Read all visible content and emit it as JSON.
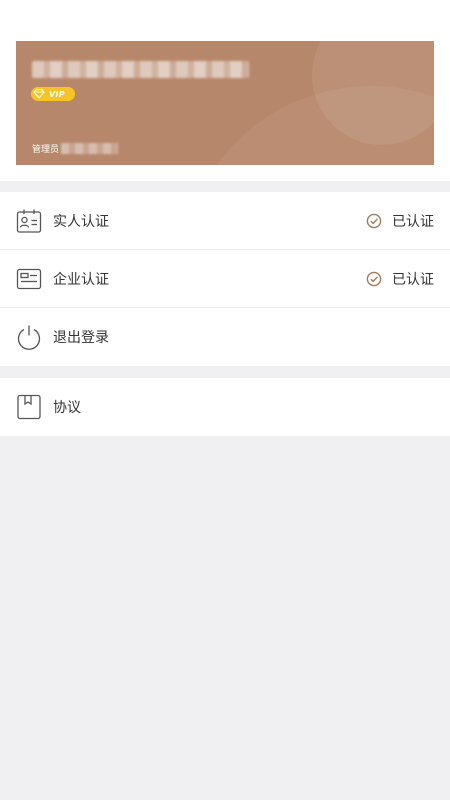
{
  "profile": {
    "vip_label": "VIP",
    "role_label": "管理员"
  },
  "menu": [
    {
      "label": "实人认证",
      "status": "已认证",
      "icon": "id-card-icon"
    },
    {
      "label": "企业认证",
      "status": "已认证",
      "icon": "business-card-icon"
    },
    {
      "label": "退出登录",
      "icon": "power-icon"
    }
  ],
  "secondary": [
    {
      "label": "协议",
      "icon": "bookmark-document-icon"
    }
  ],
  "colors": {
    "card_bg": "#b7876b",
    "vip_bg": "#f7c325",
    "check_color": "#a07a5c",
    "page_bg": "#f0eff2"
  }
}
